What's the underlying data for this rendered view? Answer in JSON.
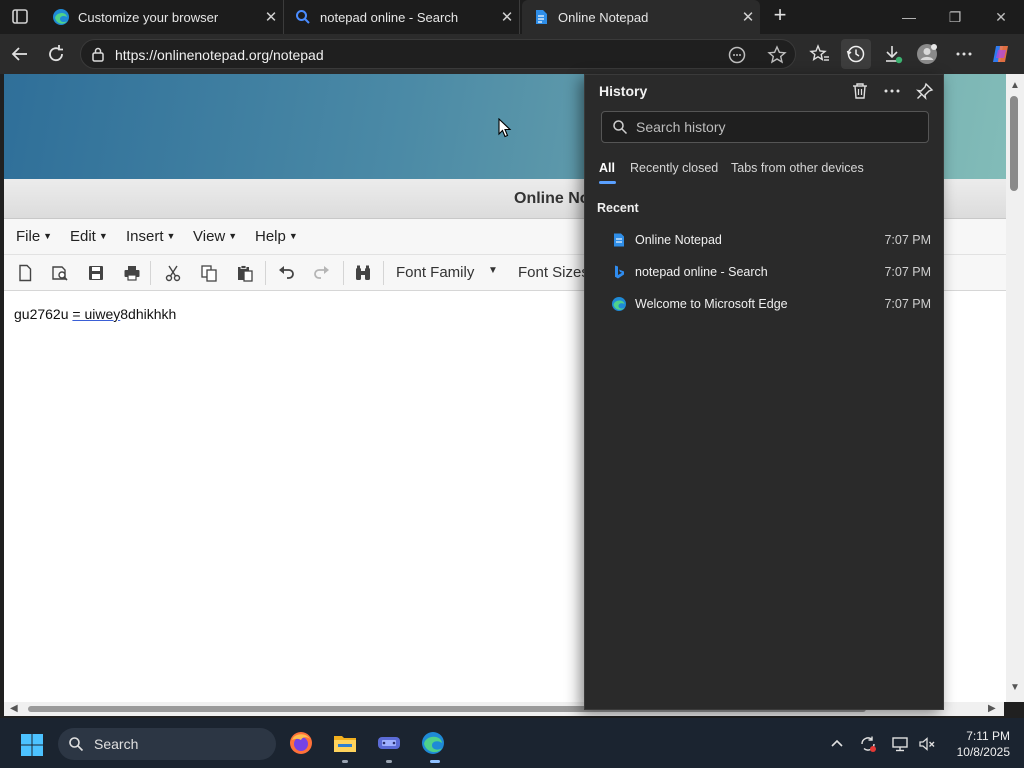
{
  "browser": {
    "tabs": [
      {
        "title": "Customize your browser",
        "icon": "edge-icon"
      },
      {
        "title": "notepad online - Search",
        "icon": "search-icon"
      },
      {
        "title": "Online Notepad",
        "icon": "notepad-icon"
      }
    ],
    "active_tab": 2,
    "url": "https://onlinenotepad.org/notepad"
  },
  "page": {
    "header_title": "Online Notep",
    "menu": [
      {
        "label": "File"
      },
      {
        "label": "Edit"
      },
      {
        "label": "Insert"
      },
      {
        "label": "View"
      },
      {
        "label": "Help"
      }
    ],
    "toolbar": {
      "font_family": "Font Family",
      "font_sizes": "Font Sizes"
    },
    "editor": {
      "part1": "gu2762u ",
      "part2": "= uiwey",
      "part3": "8dhikhkh"
    }
  },
  "history": {
    "title": "History",
    "search_placeholder": "Search history",
    "tabs": [
      {
        "label": "All"
      },
      {
        "label": "Recently closed"
      },
      {
        "label": "Tabs from other devices"
      }
    ],
    "section": "Recent",
    "items": [
      {
        "title": "Online Notepad",
        "time": "7:07 PM",
        "icon": "notepad-icon"
      },
      {
        "title": "notepad online - Search",
        "time": "7:07 PM",
        "icon": "bing-icon"
      },
      {
        "title": "Welcome to Microsoft Edge",
        "time": "7:07 PM",
        "icon": "edge-icon"
      }
    ]
  },
  "taskbar": {
    "search_label": "Search",
    "time": "7:11 PM",
    "date": "10/8/2025"
  },
  "colors": {
    "accent": "#5aa0ff",
    "banner_start": "#2f6f99",
    "banner_end": "#82bcb8"
  }
}
